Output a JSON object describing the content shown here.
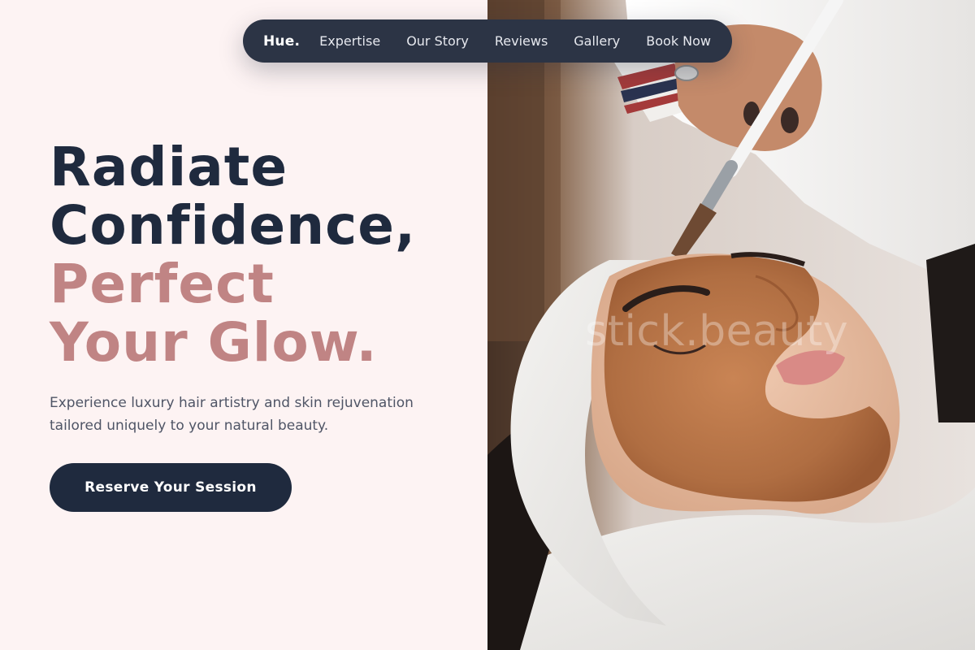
{
  "nav": {
    "brand": "Hue.",
    "links": [
      "Expertise",
      "Our Story",
      "Reviews",
      "Gallery",
      "Book Now"
    ]
  },
  "hero": {
    "headline_line1": "Radiate",
    "headline_line2": "Confidence,",
    "headline_line3": "Perfect",
    "headline_line4": "Your Glow.",
    "subcopy": "Experience luxury hair artistry and skin rejuvenation tailored uniquely to your natural beauty.",
    "cta_label": "Reserve Your Session"
  },
  "photo": {
    "watermark": "stick.beauty",
    "alt": "Woman receiving a facial mask treatment applied with a brush"
  },
  "colors": {
    "background": "#fdf3f3",
    "navy": "#1f2a3e",
    "nav_bg": "#2c3445",
    "rose": "#c08484",
    "body_text": "#4f5566"
  }
}
